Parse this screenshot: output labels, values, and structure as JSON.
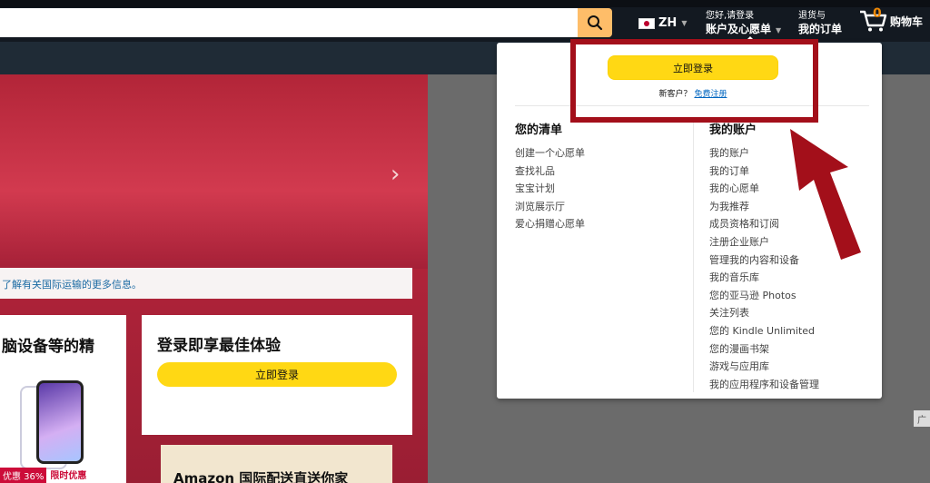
{
  "header": {
    "search_placeholder": "",
    "language": "ZH",
    "account_greeting": "您好,请登录",
    "account_label": "账户及心愿单",
    "returns_line1": "退货与",
    "returns_line2": "我的订单",
    "cart_count": "0",
    "cart_label": "购物车"
  },
  "hero": {
    "notice": "了解有关国际运输的更多信息。",
    "card1_title": "脑设备等的精",
    "card1_discount": "优惠 36%",
    "card1_deal": "限时优惠",
    "card2_title": "登录即享最佳体验",
    "card2_button": "立即登录",
    "card3_title": "Amazon 国际配送直送你家",
    "ad_tag": "广"
  },
  "flyout": {
    "signin_button": "立即登录",
    "new_customer": "新客户？",
    "register_link": "免费注册",
    "lists": {
      "title": "您的清单",
      "items": [
        "创建一个心愿单",
        "查找礼品",
        "宝宝计划",
        "浏览展示厅",
        "爱心捐赠心愿单"
      ]
    },
    "account": {
      "title": "我的账户",
      "items": [
        "我的账户",
        "我的订单",
        "我的心愿单",
        "为我推荐",
        "成员资格和订阅",
        "注册企业账户",
        "管理我的内容和设备",
        "我的音乐库",
        "您的亚马逊 Photos",
        "关注列表",
        "您的 Kindle Unlimited",
        "您的漫画书架",
        "游戏与应用库",
        "我的应用程序和设备管理"
      ]
    }
  },
  "colors": {
    "nav_dark": "#131921",
    "search_button": "#febd69",
    "signin_yellow": "#ffd814",
    "annotation_red": "#a30f1a",
    "link_blue": "#0066c0"
  }
}
